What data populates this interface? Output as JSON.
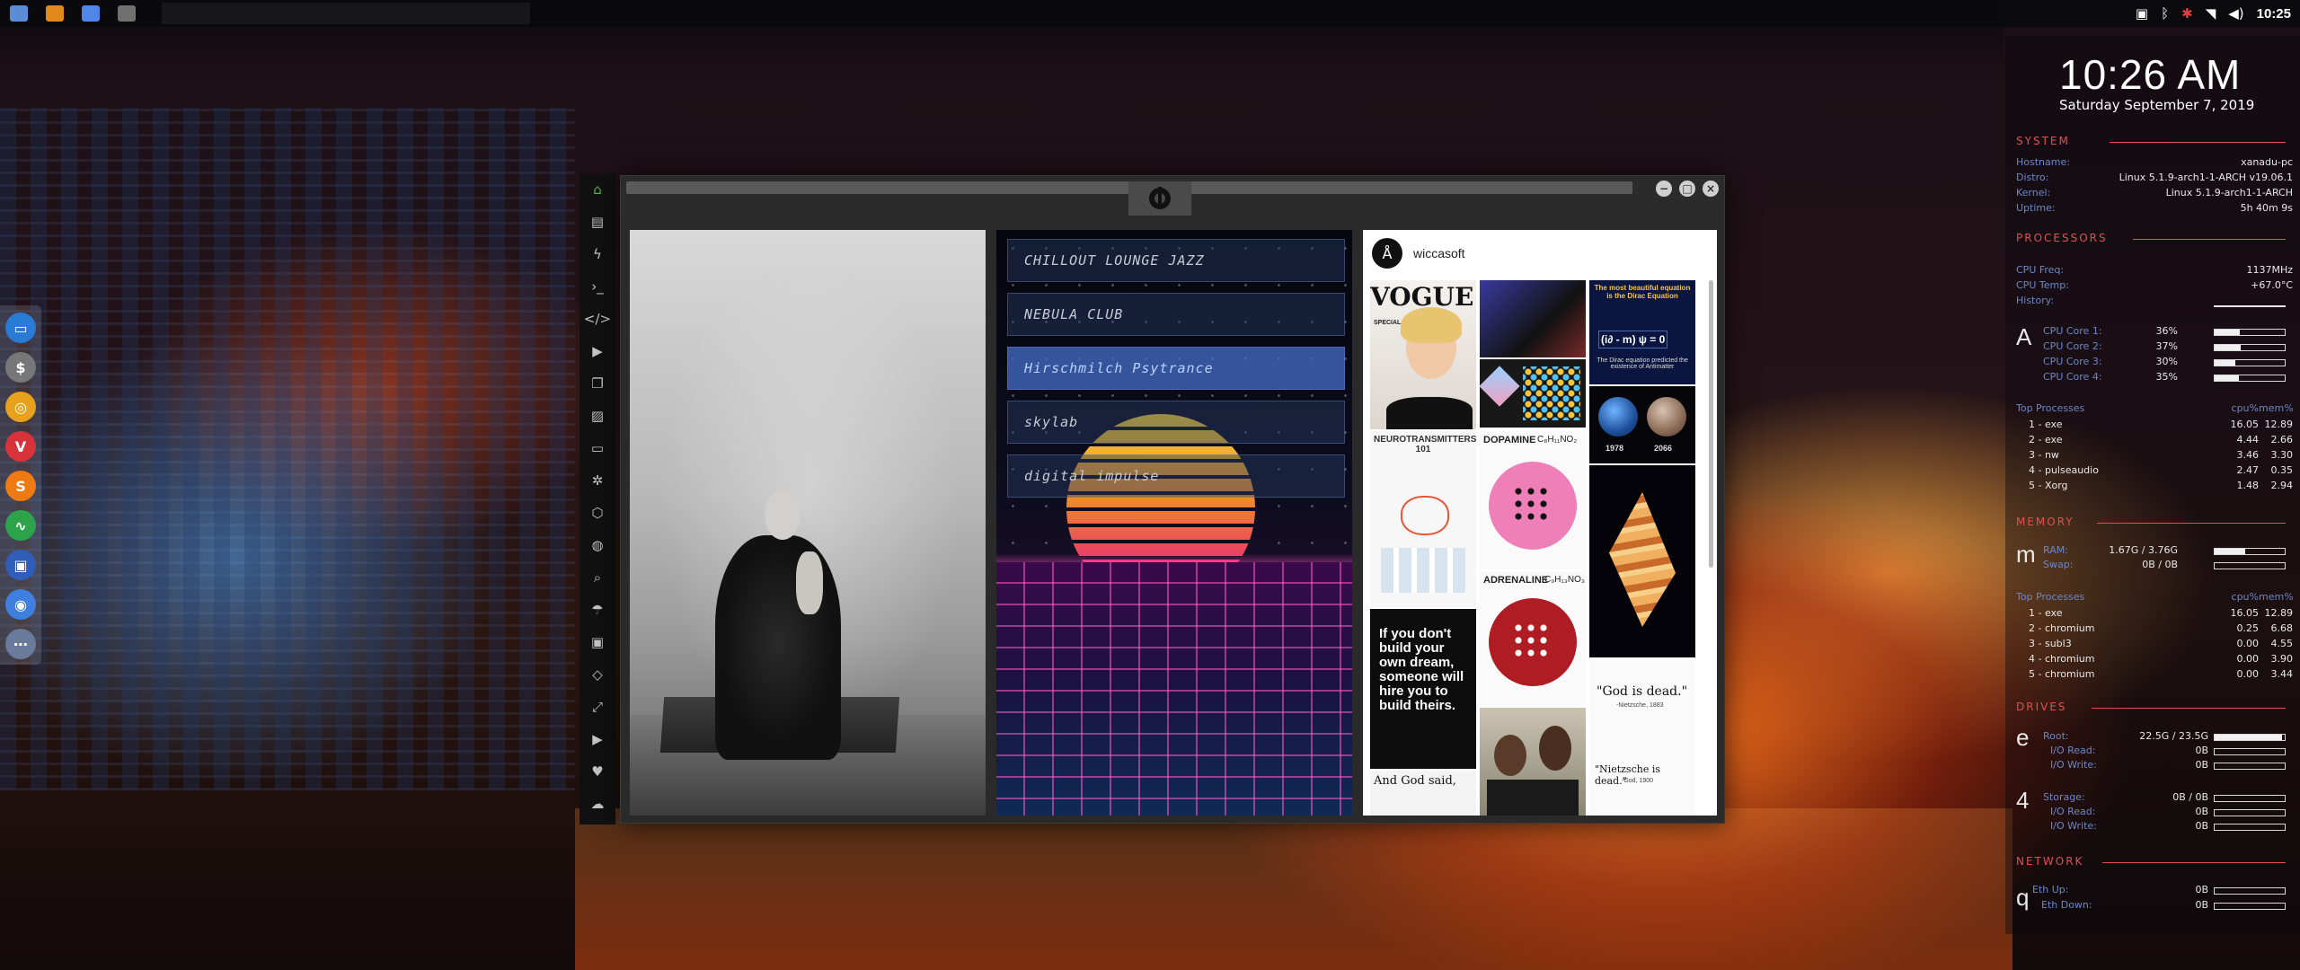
{
  "panel": {
    "launcher": [
      {
        "name": "file-manager-icon",
        "color": "#5b8dd6"
      },
      {
        "name": "sublime-icon",
        "color": "#e08a1e"
      },
      {
        "name": "chromium-icon",
        "color": "#4f86e8"
      },
      {
        "name": "active-window-icon",
        "color": "#707070"
      }
    ],
    "tray": {
      "icons": [
        "image-icon",
        "bluetooth-icon",
        "settings-icon",
        "wifi-icon",
        "volume-icon"
      ],
      "clock": "10:25"
    }
  },
  "dock": {
    "items": [
      {
        "name": "files-icon",
        "color": "#2a7bd6",
        "glyph": "▭"
      },
      {
        "name": "money-icon",
        "color": "#777777",
        "glyph": "$"
      },
      {
        "name": "lifebuoy-icon",
        "color": "#e7a11a",
        "glyph": "◎"
      },
      {
        "name": "vivaldi-icon",
        "color": "#d8323a",
        "glyph": "V"
      },
      {
        "name": "skype-s-icon",
        "color": "#f07a12",
        "glyph": "S"
      },
      {
        "name": "activity-icon",
        "color": "#2da34a",
        "glyph": "∿"
      },
      {
        "name": "screen-icon",
        "color": "#2f5db8",
        "glyph": "▣"
      },
      {
        "name": "chromium-dock-icon",
        "color": "#3f7fe0",
        "glyph": "◉"
      },
      {
        "name": "grid-icon",
        "color": "#6a7a9a",
        "glyph": "⋯"
      }
    ]
  },
  "sidebar": {
    "items": [
      {
        "name": "home-icon",
        "glyph": "⌂",
        "active": true
      },
      {
        "name": "document-icon",
        "glyph": "▤"
      },
      {
        "name": "bolt-icon",
        "glyph": "ϟ"
      },
      {
        "name": "terminal-icon",
        "glyph": "›_"
      },
      {
        "name": "code-icon",
        "glyph": "</>"
      },
      {
        "name": "play-icon",
        "glyph": "▶"
      },
      {
        "name": "copy-icon",
        "glyph": "❐"
      },
      {
        "name": "image-icon",
        "glyph": "▨"
      },
      {
        "name": "id-card-icon",
        "glyph": "▭"
      },
      {
        "name": "settings-wheel-icon",
        "glyph": "✲"
      },
      {
        "name": "hexagon-icon",
        "glyph": "⬡"
      },
      {
        "name": "globe-icon",
        "glyph": "◍"
      },
      {
        "name": "search-icon",
        "glyph": "⌕"
      },
      {
        "name": "umbrella-icon",
        "glyph": "☂"
      },
      {
        "name": "contact-icon",
        "glyph": "▣"
      },
      {
        "name": "tags-icon",
        "glyph": "◇"
      },
      {
        "name": "expand-icon",
        "glyph": "⤢"
      },
      {
        "name": "youtube-icon",
        "glyph": "▶"
      },
      {
        "name": "heart-icon",
        "glyph": "♥"
      },
      {
        "name": "cloud-icon",
        "glyph": "☁"
      }
    ]
  },
  "window": {
    "emblem": "rebel-alliance-icon",
    "controls": [
      "−",
      "□",
      "×"
    ],
    "radio": {
      "stations": [
        "CHILLOUT LOUNGE JAZZ",
        "NEBULA CLUB",
        "Hirschmilch Psytrance",
        "skylab",
        "digital impulse"
      ],
      "selected": 2
    },
    "pinterest": {
      "username": "wiccasoft",
      "tiles": {
        "vogue": "VOGUE",
        "vogue_sub": "SPECIAL",
        "dirac_title": "The most beautiful equation is the Dirac Equation",
        "dirac_eq": "(i∂ - m) ψ = 0",
        "dirac_sub": "The Dirac equation predicted the existence of Antimatter",
        "neuro": "NEUROTRANSMITTERS 101",
        "dopamine": "DOPAMINE",
        "dopamine_formula": "C₈H₁₁NO₂",
        "adrenaline": "ADRENALINE",
        "adrenaline_formula": "C₉H₁₃NO₃",
        "year1": "1978",
        "year2": "2066",
        "quote": "If you don't build your own dream, someone will hire you to build theirs.",
        "god_said": "And God said,",
        "god_dead": "\"God is dead.\"",
        "god_dead_by": "-Nietzsche, 1883",
        "nietzsche_dead": "\"Nietzsche is dead.\"",
        "nietzsche_dead_by": "-God, 1900"
      }
    }
  },
  "conky": {
    "time": "10:26 AM",
    "date": "Saturday September  7, 2019",
    "sections": {
      "system": "SYSTEM",
      "processors": "PROCESSORS",
      "memory": "MEMORY",
      "drives": "DRIVES",
      "network": "NETWORK"
    },
    "system": [
      {
        "label": "Hostname:",
        "value": "xanadu-pc"
      },
      {
        "label": "Distro:",
        "value": "Linux 5.1.9-arch1-1-ARCH v19.06.1"
      },
      {
        "label": "Kernel:",
        "value": "Linux 5.1.9-arch1-1-ARCH"
      },
      {
        "label": "Uptime:",
        "value": "5h 40m 9s"
      }
    ],
    "cpu": {
      "freq_label": "CPU Freq:",
      "freq": "1137MHz",
      "temp_label": "CPU Temp:",
      "temp": "+67.0°C",
      "history_label": "History:",
      "big": "A",
      "cores": [
        {
          "label": "CPU Core 1:",
          "value": "36%",
          "fill": 0.36
        },
        {
          "label": "CPU Core 2:",
          "value": "37%",
          "fill": 0.37
        },
        {
          "label": "CPU Core 3:",
          "value": "30%",
          "fill": 0.3
        },
        {
          "label": "CPU Core 4:",
          "value": "35%",
          "fill": 0.35
        }
      ],
      "top_label": "Top Processes",
      "col1": "cpu%",
      "col2": "mem%",
      "top": [
        {
          "n": "1 - exe",
          "a": "16.05",
          "b": "12.89"
        },
        {
          "n": "2 - exe",
          "a": "4.44",
          "b": "2.66"
        },
        {
          "n": "3 - nw",
          "a": "3.46",
          "b": "3.30"
        },
        {
          "n": "4 - pulseaudio",
          "a": "2.47",
          "b": "0.35"
        },
        {
          "n": "5 - Xorg",
          "a": "1.48",
          "b": "2.94"
        }
      ]
    },
    "memory": {
      "big": "m",
      "ram_label": "RAM:",
      "ram": "1.67G / 3.76G",
      "ram_fill": 0.44,
      "swap_label": "Swap:",
      "swap": "0B / 0B",
      "swap_fill": 0,
      "top_label": "Top Processes",
      "col1": "cpu%",
      "col2": "mem%",
      "top": [
        {
          "n": "1 - exe",
          "a": "16.05",
          "b": "12.89"
        },
        {
          "n": "2 - chromium",
          "a": "0.25",
          "b": "6.68"
        },
        {
          "n": "3 - subl3",
          "a": "0.00",
          "b": "4.55"
        },
        {
          "n": "4 - chromium",
          "a": "0.00",
          "b": "3.90"
        },
        {
          "n": "5 - chromium",
          "a": "0.00",
          "b": "3.44"
        }
      ]
    },
    "drives": {
      "big1": "e",
      "big2": "4",
      "root_label": "Root:",
      "root": "22.5G / 23.5G",
      "root_fill": 0.96,
      "io_read_label": "I/O Read:",
      "io_read": "0B",
      "io_write_label": "I/O Write:",
      "io_write": "0B",
      "storage_label": "Storage:",
      "storage": "0B / 0B",
      "storage_fill": 0,
      "io_read2_label": "I/O Read:",
      "io_read2": "0B",
      "io_write2_label": "I/O Write:",
      "io_write2": "0B"
    },
    "network": {
      "big": "q",
      "up_label": "Eth Up:",
      "up": "0B",
      "down_label": "Eth Down:",
      "down": "0B"
    }
  }
}
